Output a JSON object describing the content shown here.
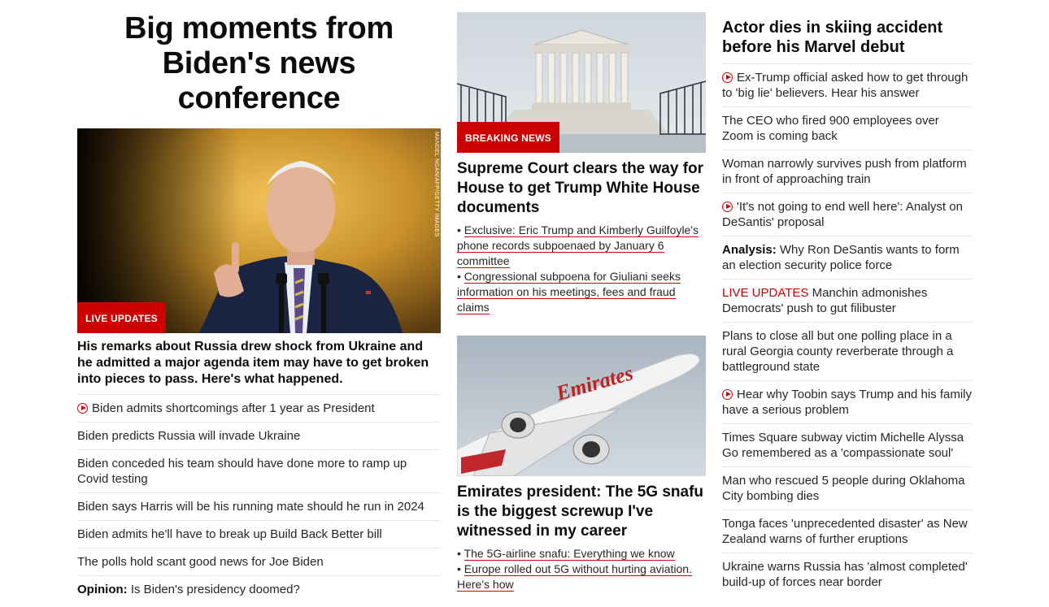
{
  "col1": {
    "title": "Big moments from Biden's news conference",
    "photo_credit": "MANDEL NGAN/AFP/GETTY IMAGES",
    "badge": "LIVE UPDATES",
    "description": "His remarks about Russia drew shock from Ukraine and he admitted a major agenda item may have to get broken into pieces to pass. Here's what happened.",
    "items": [
      {
        "text": "Biden admits shortcomings after 1 year as President",
        "video": true
      },
      {
        "text": "Biden predicts Russia will invade Ukraine"
      },
      {
        "text": "Biden conceded his team should have done more to ramp up Covid testing"
      },
      {
        "text": "Biden says Harris will be his running mate should he run in 2024"
      },
      {
        "text": "Biden admits he'll have to break up Build Back Better bill"
      },
      {
        "text": "The polls hold scant good news for Joe Biden"
      },
      {
        "prefix": "Opinion:",
        "text": "Is Biden's presidency doomed?"
      }
    ]
  },
  "col2": {
    "story1": {
      "badge": "BREAKING NEWS",
      "title": "Supreme Court clears the way for House to get Trump White House documents",
      "links": [
        "Exclusive: Eric Trump and Kimberly Guilfoyle's phone records subpoenaed by January 6 committee",
        "Congressional subpoena for Giuliani seeks information on his meetings, fees and fraud claims"
      ]
    },
    "story2": {
      "plane_text": "Emirates",
      "title": "Emirates president: The 5G snafu is the biggest screwup I've witnessed in my career",
      "links": [
        "The 5G-airline snafu: Everything we know",
        "Europe rolled out 5G without hurting aviation. Here's how"
      ]
    }
  },
  "col3": {
    "title": "Actor dies in skiing accident before his Marvel debut",
    "items": [
      {
        "text": "Ex-Trump official asked how to get through to 'big lie' believers. Hear his answer",
        "video": true
      },
      {
        "text": "The CEO who fired 900 employees over Zoom is coming back"
      },
      {
        "text": "Woman narrowly survives push from platform in front of approaching train"
      },
      {
        "text": "'It's not going to end well here': Analyst on DeSantis' proposal",
        "video": true
      },
      {
        "prefix": "Analysis:",
        "text": "Why Ron DeSantis wants to form an election security police force"
      },
      {
        "red_prefix": "LIVE UPDATES",
        "text": "Manchin admonishes Democrats' push to gut filibuster"
      },
      {
        "text": "Plans to close all but one polling place in a rural Georgia county reverberate through a battleground state"
      },
      {
        "text": "Hear why Toobin says Trump and his family have a serious problem",
        "video": true
      },
      {
        "text": "Times Square subway victim Michelle Alyssa Go remembered as a 'compassionate soul'"
      },
      {
        "text": "Man who rescued 5 people during Oklahoma City bombing dies"
      },
      {
        "text": "Tonga faces 'unprecedented disaster' as New Zealand warns of further eruptions"
      },
      {
        "text": "Ukraine warns Russia has 'almost completed' build-up of forces near border"
      }
    ]
  },
  "colors": {
    "accent": "#cc0000",
    "text": "#0c0c0c",
    "divider": "#e6e6e6"
  }
}
